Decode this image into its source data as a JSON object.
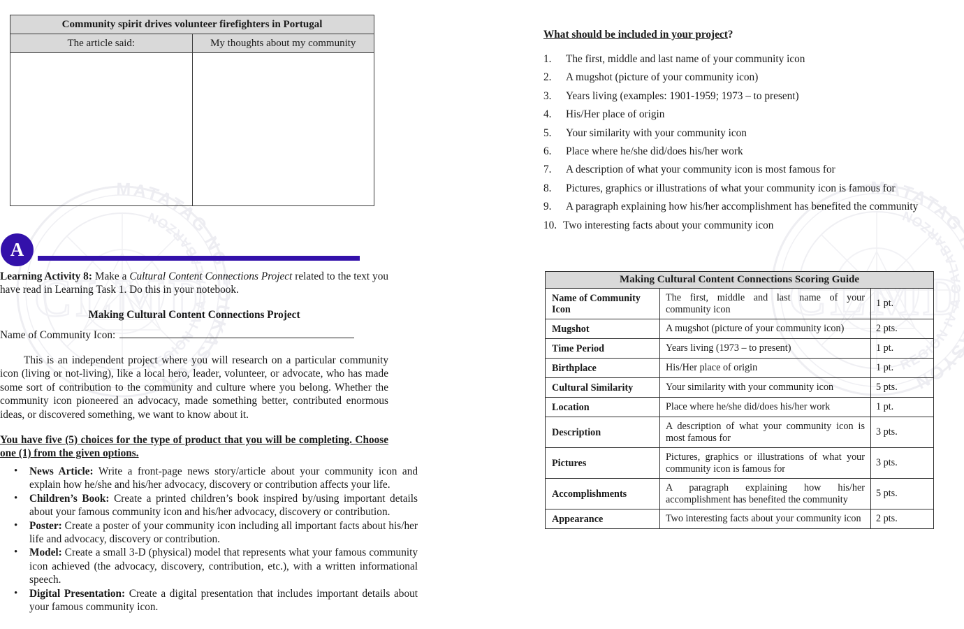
{
  "document": {
    "left_column": {
      "article_table": {
        "title": "Community spirit drives volunteer firefighters in Portugal",
        "col1_header": "The article said:",
        "col2_header": "My thoughts about my community",
        "col1_body": "",
        "col2_body": ""
      },
      "activity_badge": {
        "letter": "A",
        "accent_color": "#3311aa"
      },
      "activity_intro": {
        "label": "Learning Activity 8:",
        "text_before_italic": " Make a ",
        "italic": "Cultural Content Connections Project",
        "text_after_italic": " related to the text you have read in Learning Task 1.  Do this in your notebook."
      },
      "project_title": "Making Cultural Content Connections Project",
      "name_field": {
        "label": "Name of Community Icon:",
        "value": ""
      },
      "paragraph": "This is an independent project where you will research on a particular community icon (living or not-living), like a local hero, leader, volunteer, or advocate, who has made some sort of contribution to the community and culture where you belong.  Whether the community icon pioneered an advocacy, made something better, contributed enormous ideas, or discovered something, we want to know about it.",
      "choices_heading": "You have five (5) choices for the type of product that you will be completing. Choose one (1) from the given options.",
      "choices": [
        {
          "label": "News Article:",
          "text": " Write a front-page news story/article about your community icon and explain how he/she and his/her advocacy, discovery or contribution affects your life."
        },
        {
          "label": "Children’s Book:",
          "text": " Create a printed children’s book inspired by/using important details about your famous community icon and his/her advocacy, discovery or contribution."
        },
        {
          "label": "Poster:",
          "text": " Create a poster of your community icon including all important facts about his/her life and advocacy, discovery or contribution."
        },
        {
          "label": "Model:",
          "text": " Create a small 3-D (physical) model that represents what your famous community icon achieved (the advocacy, discovery, contribution, etc.), with a written informational speech."
        },
        {
          "label": "Digital Presentation:",
          "text": " Create a digital presentation that includes important details about your famous community icon."
        }
      ]
    },
    "right_column": {
      "include_heading": {
        "underlined": "What should be included in your project",
        "tail": "?"
      },
      "include_items": [
        {
          "num": "1.",
          "text": "The first, middle and last name of your community icon"
        },
        {
          "num": "2.",
          "text": "A mugshot (picture of your community icon)"
        },
        {
          "num": "3.",
          "text": "Years living (examples: 1901-1959; 1973 – to present)"
        },
        {
          "num": "4.",
          "text": "His/Her place of origin"
        },
        {
          "num": "5.",
          "text": "Your similarity with your community icon"
        },
        {
          "num": "6.",
          "text": "Place where he/she did/does his/her work"
        },
        {
          "num": "7.",
          "text": "A description of what your community icon is most famous for"
        },
        {
          "num": "8.",
          "text": "Pictures, graphics or illustrations of what your community icon is famous for"
        },
        {
          "num": "9.",
          "text": "A paragraph explaining how his/her accomplishment has benefited the community"
        },
        {
          "num": "10.",
          "text": "Two interesting facts about your community icon"
        }
      ],
      "scoring_guide": {
        "title": "Making Cultural Content Connections Scoring Guide",
        "rows": [
          {
            "criterion": "Name of Community Icon",
            "description": "The first, middle and last name of your community icon",
            "points": "1 pt."
          },
          {
            "criterion": "Mugshot",
            "description": "A mugshot (picture of your community icon)",
            "points": "2 pts."
          },
          {
            "criterion": "Time Period",
            "description": "Years living (1973 – to present)",
            "points": "1 pt."
          },
          {
            "criterion": "Birthplace",
            "description": "His/Her place of origin",
            "points": "1 pt."
          },
          {
            "criterion": "Cultural Similarity",
            "description": "Your similarity with your community icon",
            "points": "5 pts."
          },
          {
            "criterion": "Location",
            "description": "Place where he/she did/does his/her work",
            "points": "1 pt."
          },
          {
            "criterion": "Description",
            "description": "A description of what your community icon is most famous for",
            "points": "3 pts."
          },
          {
            "criterion": "Pictures",
            "description": "Pictures, graphics or illustrations of what your community icon  is famous for",
            "points": "3 pts."
          },
          {
            "criterion": "Accomplishments",
            "description": "A paragraph explaining how his/her accomplishment has benefited the community",
            "points": "5 pts."
          },
          {
            "criterion": "Appearance",
            "description": "Two interesting facts about your community icon",
            "points": "2 pts."
          }
        ]
      }
    },
    "watermark": {
      "ring_text": "MATATAG • LEARNING • NG EDUKASYON •",
      "center_text": "CLMD",
      "sub_text": "REGION IV-A CALABARZON"
    }
  }
}
